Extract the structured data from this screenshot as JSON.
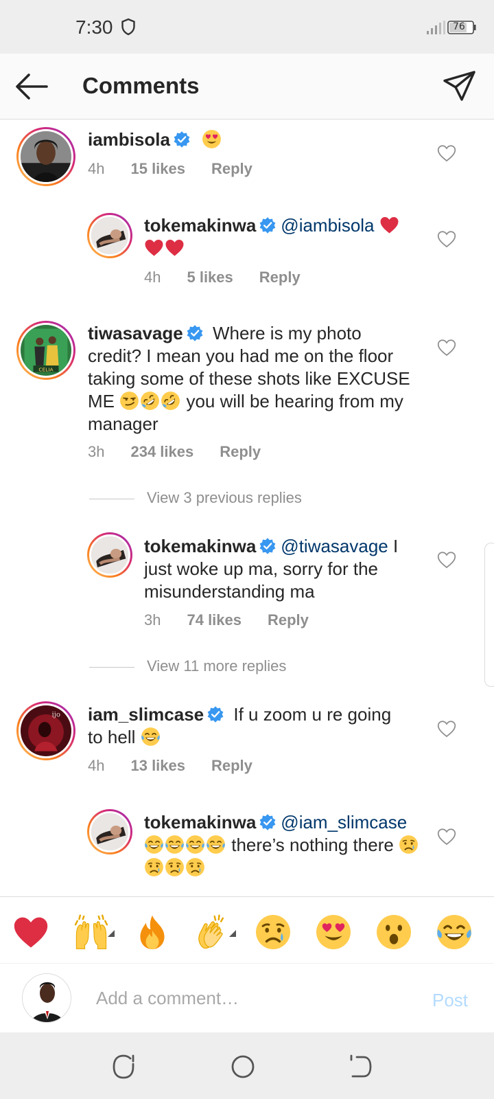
{
  "status_bar": {
    "time": "7:30",
    "battery": "76"
  },
  "header": {
    "title": "Comments"
  },
  "comments": [
    {
      "username": "iambisola",
      "text": "",
      "emojis": [
        "heart-eyes"
      ],
      "time": "4h",
      "likes": "15 likes",
      "reply": "Reply"
    },
    {
      "username": "tokemakinwa",
      "mention": "@iambisola",
      "text": "",
      "emojis": [
        "red-heart",
        "red-heart",
        "red-heart"
      ],
      "time": "4h",
      "likes": "5 likes",
      "reply": "Reply"
    },
    {
      "username": "tiwasavage",
      "text_a": "Where is my photo credit? I mean you had me on the floor taking some of these shots like EXCUSE ME",
      "emojis": [
        "smirk",
        "rofl",
        "rofl"
      ],
      "text_b": "you will be hearing from my manager",
      "time": "3h",
      "likes": "234 likes",
      "reply": "Reply"
    },
    {
      "username": "tokemakinwa",
      "mention": "@tiwasavage",
      "text": "I just woke up ma, sorry for the misunderstanding ma",
      "time": "3h",
      "likes": "74 likes",
      "reply": "Reply"
    },
    {
      "username": "iam_slimcase",
      "text": "If u zoom u re going to hell",
      "emojis": [
        "joy"
      ],
      "time": "4h",
      "likes": "13 likes",
      "reply": "Reply"
    },
    {
      "username": "tokemakinwa",
      "mention": "@iam_slimcase",
      "emojis_a": [
        "joy",
        "joy",
        "joy",
        "joy"
      ],
      "text": "there’s nothing there",
      "emojis_b": [
        "cry",
        "cry",
        "cry",
        "cry"
      ]
    }
  ],
  "view_replies": {
    "previous": "View 3 previous replies",
    "more": "View 11 more replies"
  },
  "emoji_bar": [
    "red-heart",
    "raising-hands",
    "fire",
    "clapping-hands",
    "crying-face",
    "heart-eyes",
    "astonished-face",
    "tears-of-joy"
  ],
  "input": {
    "placeholder": "Add a comment…",
    "post_label": "Post"
  },
  "colors": {
    "link": "#00376b",
    "muted": "#8e8e8e",
    "verified": "#3897f0",
    "post_disabled": "#b3dbff"
  }
}
